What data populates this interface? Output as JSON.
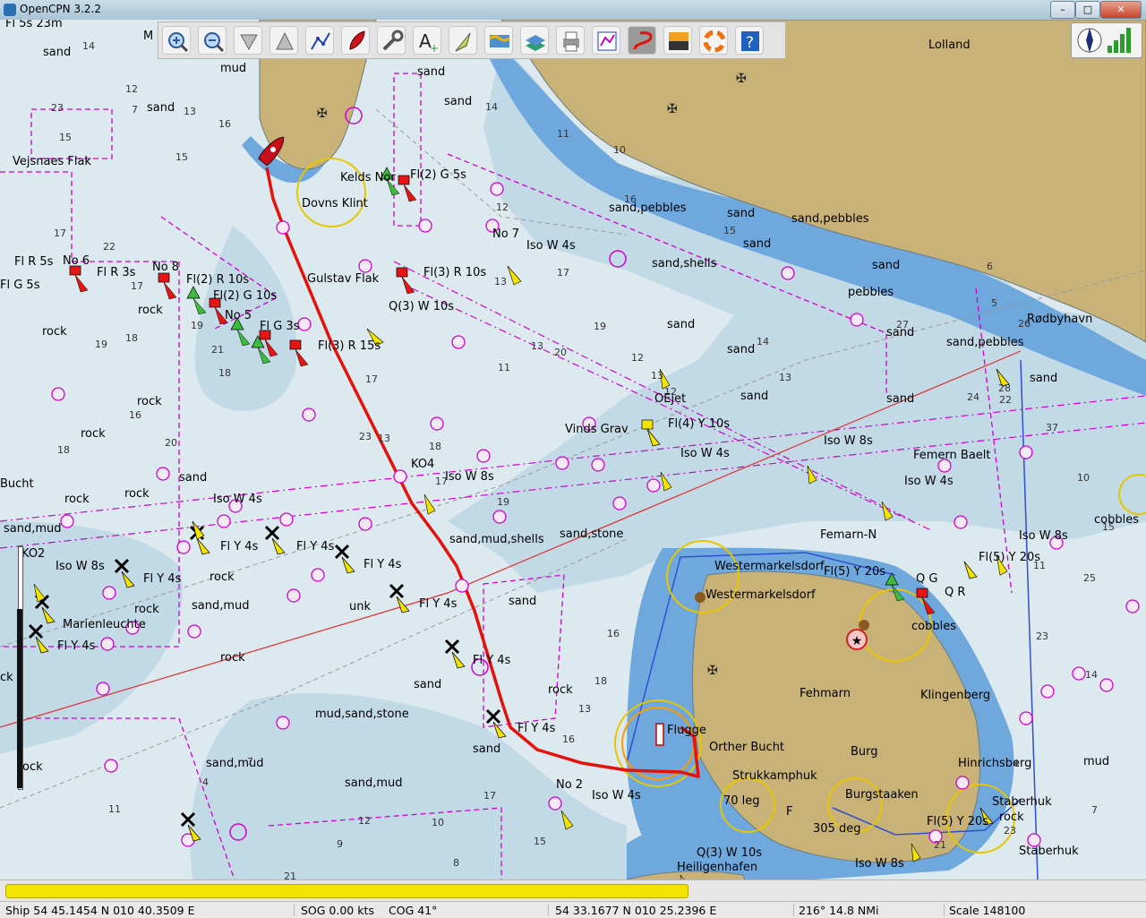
{
  "window": {
    "title": "OpenCPN 3.2.2",
    "controls": [
      "minimize",
      "maximize",
      "close"
    ]
  },
  "toolbar": {
    "tools": [
      {
        "name": "zoom-in-icon"
      },
      {
        "name": "zoom-out-icon"
      },
      {
        "name": "scale-in-icon"
      },
      {
        "name": "scale-out-icon"
      },
      {
        "name": "route-icon"
      },
      {
        "name": "follow-ship-icon"
      },
      {
        "name": "settings-icon"
      },
      {
        "name": "text-icon"
      },
      {
        "name": "current-icon"
      },
      {
        "name": "tide-icon"
      },
      {
        "name": "layers-icon"
      },
      {
        "name": "print-icon"
      },
      {
        "name": "route-manager-icon"
      },
      {
        "name": "track-icon",
        "active": true
      },
      {
        "name": "color-scheme-icon"
      },
      {
        "name": "mob-icon"
      },
      {
        "name": "help-icon"
      }
    ]
  },
  "gps_panel": {
    "compass": "compass-icon",
    "signal": "gps-signal-icon"
  },
  "map": {
    "labels": [
      {
        "t": "Fl 5s 23m"
      },
      {
        "t": "sand"
      },
      {
        "t": "M"
      },
      {
        "t": "mud"
      },
      {
        "t": "sand"
      },
      {
        "t": "Vejsnaes Flak"
      },
      {
        "t": "Lolland"
      },
      {
        "t": "sand"
      },
      {
        "t": "sand"
      },
      {
        "t": "Kelds Nor"
      },
      {
        "t": "Fl(2) G 5s"
      },
      {
        "t": "Dovns Klint"
      },
      {
        "t": "sand,pebbles"
      },
      {
        "t": "sand"
      },
      {
        "t": "sand,pebbles"
      },
      {
        "t": "No 7"
      },
      {
        "t": "Iso W 4s"
      },
      {
        "t": "sand"
      },
      {
        "t": "sand,shells"
      },
      {
        "t": "sand"
      },
      {
        "t": "pebbles"
      },
      {
        "t": "sand"
      },
      {
        "t": "Fl R 5s"
      },
      {
        "t": "No 6"
      },
      {
        "t": "Fl R 3s"
      },
      {
        "t": "No 8"
      },
      {
        "t": "Fl G 5s"
      },
      {
        "t": "Fl(2) R 10s"
      },
      {
        "t": "Gulstav Flak"
      },
      {
        "t": "Fl(3) R 10s"
      },
      {
        "t": "Fl(2) G 10s"
      },
      {
        "t": "rock"
      },
      {
        "t": "No 5"
      },
      {
        "t": "Q(3) W 10s"
      },
      {
        "t": "Rødbyhavn"
      },
      {
        "t": "rock"
      },
      {
        "t": "Fl G 3s"
      },
      {
        "t": "sand"
      },
      {
        "t": "sand,pebbles"
      },
      {
        "t": "Fl(3) R 15s"
      },
      {
        "t": "sand"
      },
      {
        "t": "sand"
      },
      {
        "t": "rock"
      },
      {
        "t": "OEjet"
      },
      {
        "t": "sand"
      },
      {
        "t": "sand"
      },
      {
        "t": "Vinds Grav"
      },
      {
        "t": "Fl(4) Y 10s"
      },
      {
        "t": "rock"
      },
      {
        "t": "Iso W 8s"
      },
      {
        "t": "Iso W 4s"
      },
      {
        "t": "Femern Baelt"
      },
      {
        "t": "KO4"
      },
      {
        "t": "Iso W 8s"
      },
      {
        "t": "sand"
      },
      {
        "t": "Iso W 4s"
      },
      {
        "t": "Bucht"
      },
      {
        "t": "rock"
      },
      {
        "t": "rock"
      },
      {
        "t": "Iso W 4s"
      },
      {
        "t": "sand,mud"
      },
      {
        "t": "sand,mud,shells"
      },
      {
        "t": "sand,stone"
      },
      {
        "t": "Femarn-N"
      },
      {
        "t": "Iso W 8s"
      },
      {
        "t": "cobbles"
      },
      {
        "t": "KO2"
      },
      {
        "t": "Iso W 8s"
      },
      {
        "t": "Fl Y 4s"
      },
      {
        "t": "Fl Y 4s"
      },
      {
        "t": "Fl Y 4s"
      },
      {
        "t": "Fl Y 4s"
      },
      {
        "t": "Westermarkelsdorf"
      },
      {
        "t": "Fl(5) Y 20s"
      },
      {
        "t": "Fl(5) Y 20s"
      },
      {
        "t": "rock"
      },
      {
        "t": "sand"
      },
      {
        "t": "Westermarkelsdorf"
      },
      {
        "t": "Q G"
      },
      {
        "t": "Q R"
      },
      {
        "t": "sand,mud"
      },
      {
        "t": "unk"
      },
      {
        "t": "Fl Y 4s"
      },
      {
        "t": "rock"
      },
      {
        "t": "cobbles"
      },
      {
        "t": "Marienleuchte"
      },
      {
        "t": "Fl Y 4s"
      },
      {
        "t": "rock"
      },
      {
        "t": "Fl Y 4s"
      },
      {
        "t": "sand"
      },
      {
        "t": "rock"
      },
      {
        "t": "Fehmarn"
      },
      {
        "t": "Klingenberg"
      },
      {
        "t": "mud,sand,stone"
      },
      {
        "t": "Fl Y 4s"
      },
      {
        "t": "Flugge"
      },
      {
        "t": "Orther Bucht"
      },
      {
        "t": "Burg"
      },
      {
        "t": "sand"
      },
      {
        "t": "rock"
      },
      {
        "t": "sand,mud"
      },
      {
        "t": "Hinrichsberg"
      },
      {
        "t": "mud"
      },
      {
        "t": "sand,mud"
      },
      {
        "t": "Strukkamphuk"
      },
      {
        "t": "No 2"
      },
      {
        "t": "Iso W 4s"
      },
      {
        "t": "Burgstaaken"
      },
      {
        "t": "Staberhuk"
      },
      {
        "t": "70 leg"
      },
      {
        "t": "Fl(5) Y 20s"
      },
      {
        "t": "rock"
      },
      {
        "t": "305 deg"
      },
      {
        "t": "Q(3) W 10s"
      },
      {
        "t": "Heiligenhafen"
      },
      {
        "t": "Iso W 8s"
      },
      {
        "t": "Staberhuk"
      },
      {
        "t": "F"
      },
      {
        "t": "ck"
      }
    ],
    "depths": [
      "14",
      "12",
      "7",
      "23",
      "15",
      "16",
      "15",
      "13",
      "17",
      "22",
      "17",
      "18",
      "19",
      "16",
      "21",
      "19",
      "18",
      "20",
      "18",
      "17",
      "23",
      "18",
      "17",
      "19",
      "13",
      "14",
      "12",
      "11",
      "10",
      "16",
      "15",
      "17",
      "13",
      "13",
      "11",
      "20",
      "13",
      "12",
      "12",
      "19",
      "14",
      "13",
      "6",
      "5",
      "26",
      "27",
      "28",
      "22",
      "24",
      "37",
      "10",
      "15",
      "11",
      "25",
      "23",
      "14",
      "7",
      "4",
      "23",
      "21",
      "22",
      "16",
      "18",
      "13",
      "16",
      "17",
      "15",
      "10",
      "8",
      "5",
      "12",
      "9",
      "21",
      "7",
      "4",
      "11",
      "6"
    ]
  },
  "statusbar": {
    "ship": "Ship 54 45.1454 N   010 40.3509 E",
    "sog": "SOG 0.00 kts",
    "cog": "COG 41°",
    "cursor": "54 33.1677 N   010 25.2396 E",
    "bearing_range": "216°   14.8 NMi",
    "scale": "Scale 148100"
  },
  "progress": {
    "fraction": 0.6
  },
  "colors": {
    "land": "#c9b278",
    "shallow_water": "#6fa8dc",
    "mid_water": "#c2d9e6",
    "deep_water": "#dce9ee",
    "track": "#e3120b",
    "cable": "#d000d0",
    "route_line": "#3050d0"
  }
}
